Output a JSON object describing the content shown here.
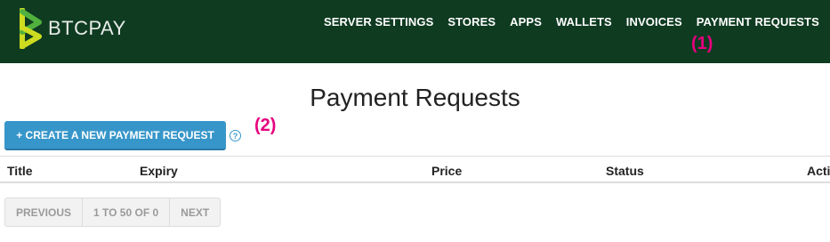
{
  "brand": {
    "name": "BTCPAY",
    "logo_icon": "btcpay-logo-icon"
  },
  "nav": {
    "items": [
      {
        "label": "SERVER SETTINGS"
      },
      {
        "label": "STORES"
      },
      {
        "label": "APPS"
      },
      {
        "label": "WALLETS"
      },
      {
        "label": "INVOICES"
      },
      {
        "label": "PAYMENT REQUESTS"
      }
    ],
    "user_icon": "user-icon",
    "logout_icon": "logout-icon"
  },
  "annotations": {
    "one": "(1)",
    "two": "(2)"
  },
  "main": {
    "title": "Payment Requests",
    "create_button_label": "+ CREATE A NEW PAYMENT REQUEST",
    "help_icon_glyph": "?"
  },
  "table": {
    "columns": [
      "Title",
      "Expiry",
      "Price",
      "Status",
      "Acti"
    ]
  },
  "pagination": {
    "previous": "PREVIOUS",
    "range": "1 TO 50 OF 0",
    "next": "NEXT"
  },
  "colors": {
    "navbar": "#0f3b21",
    "accent": "#3796c9",
    "annotation": "#e6007e"
  }
}
